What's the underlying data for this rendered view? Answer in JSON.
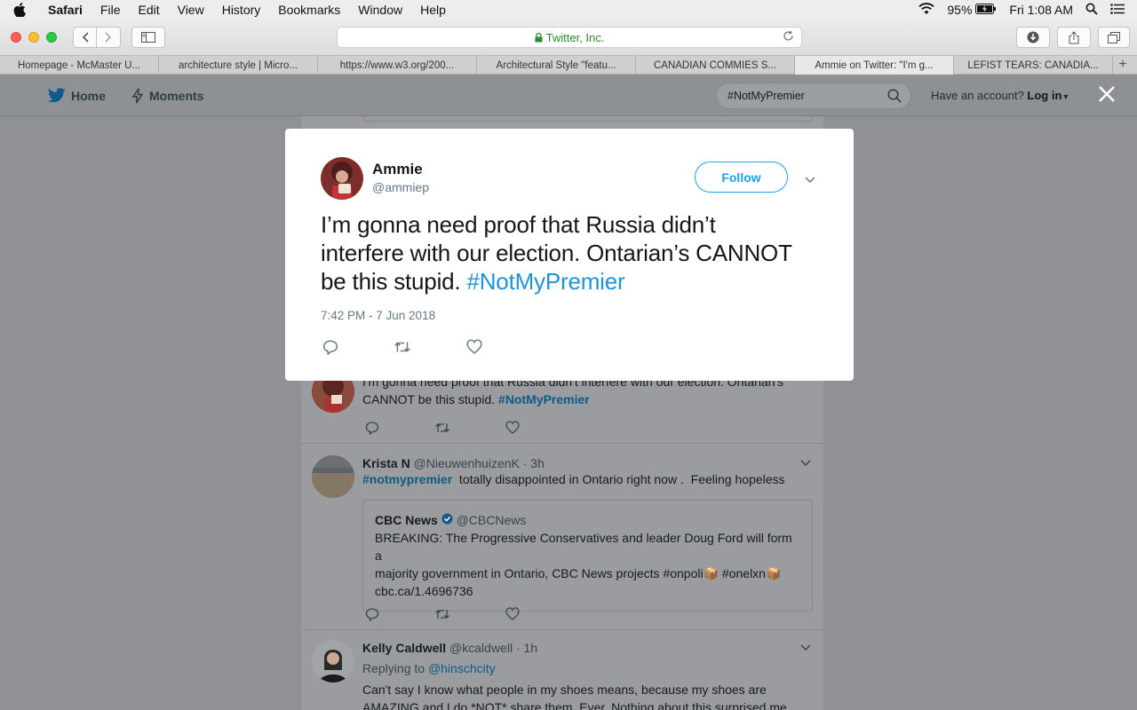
{
  "menubar": {
    "app": "Safari",
    "items": [
      "File",
      "Edit",
      "View",
      "History",
      "Bookmarks",
      "Window",
      "Help"
    ],
    "battery": "95%",
    "clock": "Fri 1:08 AM"
  },
  "toolbar": {
    "address": "Twitter, Inc."
  },
  "tabs": [
    "Homepage - McMaster U...",
    "architecture style | Micro...",
    "https://www.w3.org/200...",
    "Architectural Style \"featu...",
    "CANADIAN COMMIES S...",
    "Ammie on Twitter: \"I'm g...",
    "LEFIST TEARS: CANADIA..."
  ],
  "twitter_header": {
    "home": "Home",
    "moments": "Moments",
    "search_value": "#NotMyPremier",
    "account_prefix": "Have an account?",
    "login": "Log in"
  },
  "modal": {
    "name": "Ammie",
    "handle": "@ammiep",
    "follow": "Follow",
    "text_main": "I’m gonna need proof that Russia didn’t interfere with our election. Ontarian’s CANNOT be this stupid. ",
    "hashtag": "#NotMyPremier",
    "timestamp": "7:42 PM - 7 Jun 2018"
  },
  "timeline": {
    "tweet1": {
      "text_line1": "I'm gonna need proof that Russia didn't interfere with our election. Ontarian's",
      "text_line2": "CANNOT be this stupid. ",
      "hashtag": "#NotMyPremier"
    },
    "tweet2": {
      "name": "Krista N",
      "handle": "@NieuwenhuizenK",
      "age": "· 3h",
      "hashtag": "#notmypremier",
      "text": "  totally disappointed in Ontario right now .  Feeling hopeless",
      "quote": {
        "name": "CBC News",
        "handle": "@CBCNews",
        "line1": "BREAKING: The Progressive Conservatives and leader Doug Ford will form a",
        "line2": "majority government in Ontario, CBC News projects #onpoli📦 #onelxn📦",
        "line3": "cbc.ca/1.4696736"
      }
    },
    "tweet3": {
      "name": "Kelly Caldwell",
      "handle": "@kcaldwell",
      "age": "· 1h",
      "replying_prefix": "Replying to ",
      "replying_to": "@hinschcity",
      "line1": "Can't say I know what people in my shoes means, because my shoes are",
      "line2": "AMAZING and I do *NOT* share them. Ever. Nothing about this surprised me."
    }
  },
  "colors": {
    "twitter_blue": "#1da1f2",
    "hashtag_blue": "#1b95e0",
    "overlay_gray": "#8f9194"
  },
  "icons": [
    "apple-icon",
    "wifi-icon",
    "battery-icon",
    "spotlight-icon",
    "menu-icon",
    "back-icon",
    "forward-icon",
    "sidebar-icon",
    "lock-icon",
    "reload-icon",
    "download-icon",
    "share-icon",
    "tabs-icon",
    "twitter-bird-icon",
    "lightning-icon",
    "search-icon",
    "close-icon",
    "reply-icon",
    "retweet-icon",
    "like-icon",
    "chevron-down-icon",
    "verified-icon"
  ]
}
